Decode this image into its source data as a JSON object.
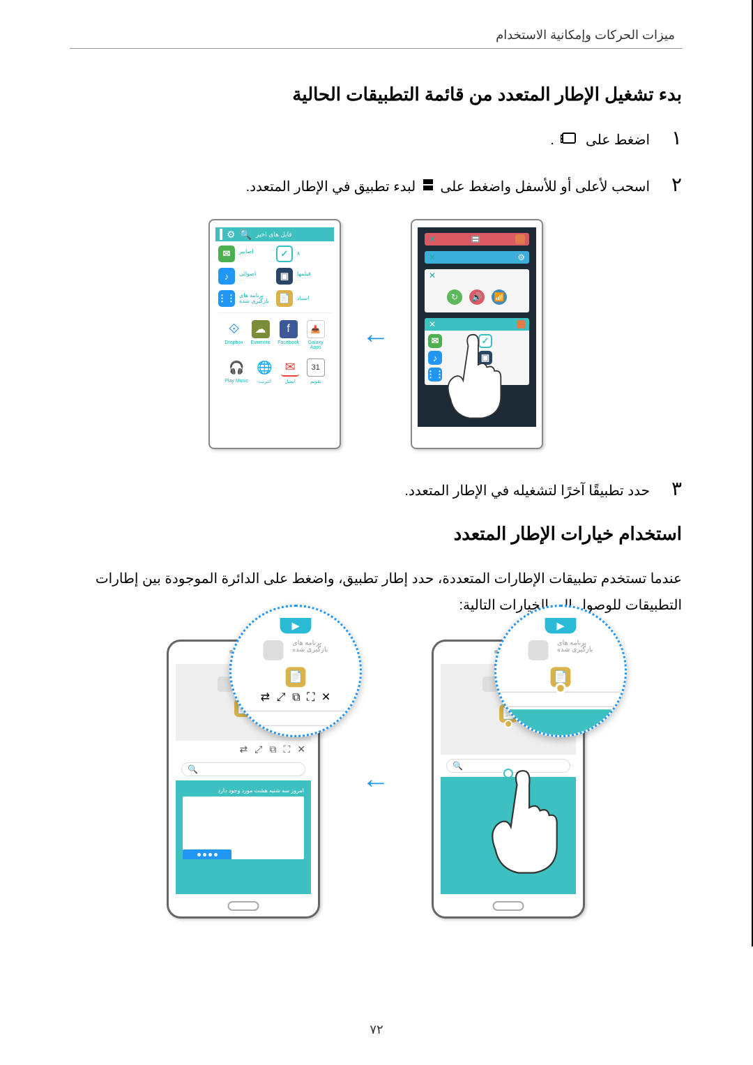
{
  "header": "ميزات الحركات وإمكانية الاستخدام",
  "section1": {
    "title": "بدء تشغيل الإطار المتعدد من قائمة التطبيقات الحالية",
    "step1_num": "١",
    "step1_a": "اضغط على ",
    "step1_b": ".",
    "step2_num": "٢",
    "step2_a": "اسحب لأعلى أو للأسفل واضغط على ",
    "step2_b": " لبدء تطبيق في الإطار المتعدد.",
    "step3_num": "٣",
    "step3_text": "حدد تطبيقًا آخرًا لتشغيله في الإطار المتعدد."
  },
  "section2": {
    "title": "استخدام خيارات الإطار المتعدد",
    "para": "عندما تستخدم تطبيقات الإطارات المتعددة، حدد إطار تطبيق، واضغط على الدائرة الموجودة بين إطارات التطبيقات للوصول إلى الخيارات التالية:"
  },
  "page_number": "٧٢",
  "icons": {
    "recent": "recent-apps-icon",
    "multiwindow": "multiwindow-icon"
  }
}
